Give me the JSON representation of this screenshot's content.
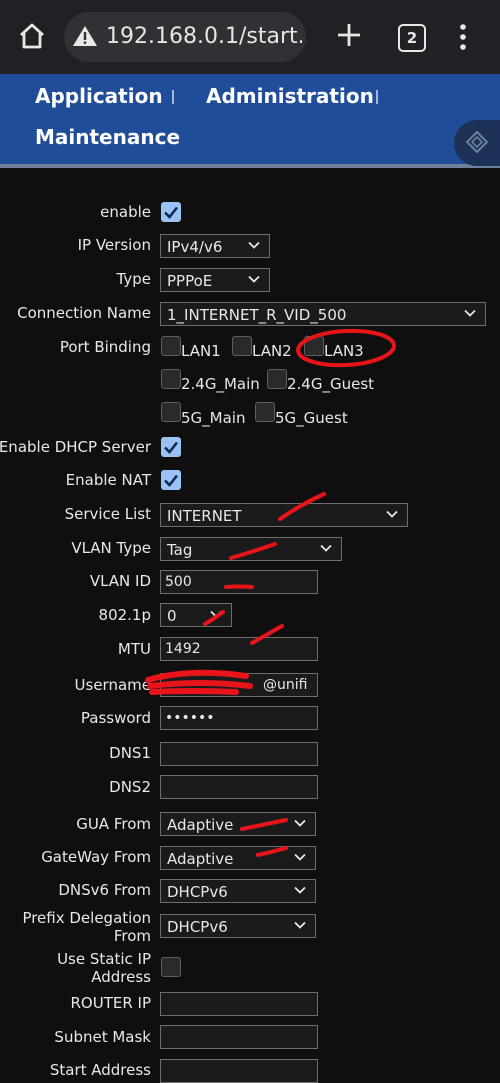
{
  "browser": {
    "url": "192.168.0.1/start.g",
    "tab_count": "2"
  },
  "nav": {
    "items": [
      "Application",
      "Administration",
      "Maintenance"
    ]
  },
  "form": {
    "enable_label": "enable",
    "enable_checked": true,
    "ip_version_label": "IP Version",
    "ip_version_value": "IPv4/v6",
    "type_label": "Type",
    "type_value": "PPPoE",
    "connection_name_label": "Connection Name",
    "connection_name_value": "1_INTERNET_R_VID_500",
    "port_binding_label": "Port Binding",
    "ports": [
      {
        "label": "LAN1",
        "checked": false
      },
      {
        "label": "LAN2",
        "checked": false
      },
      {
        "label": "LAN3",
        "checked": false
      },
      {
        "label": "2.4G_Main",
        "checked": false
      },
      {
        "label": "2.4G_Guest",
        "checked": false
      },
      {
        "label": "5G_Main",
        "checked": false
      },
      {
        "label": "5G_Guest",
        "checked": false
      }
    ],
    "dhcp_label": "Enable DHCP Server",
    "dhcp_checked": true,
    "nat_label": "Enable NAT",
    "nat_checked": true,
    "service_list_label": "Service List",
    "service_list_value": "INTERNET",
    "vlan_type_label": "VLAN Type",
    "vlan_type_value": "Tag",
    "vlan_id_label": "VLAN ID",
    "vlan_id_value": "500",
    "p8021_label": "802.1p",
    "p8021_value": "0",
    "mtu_label": "MTU",
    "mtu_value": "1492",
    "username_label": "Username",
    "username_value": "@unifi",
    "password_label": "Password",
    "password_value": "••••••",
    "dns1_label": "DNS1",
    "dns1_value": "",
    "dns2_label": "DNS2",
    "dns2_value": "",
    "gua_from_label": "GUA From",
    "gua_from_value": "Adaptive",
    "gateway_from_label": "GateWay From",
    "gateway_from_value": "Adaptive",
    "dnsv6_from_label": "DNSv6 From",
    "dnsv6_from_value": "DHCPv6",
    "prefix_label_1": "Prefix Delegation",
    "prefix_label_2": "From",
    "prefix_value": "DHCPv6",
    "static_ip_label_1": "Use Static IP",
    "static_ip_label_2": "Address",
    "static_ip_checked": false,
    "router_ip_label": "ROUTER IP",
    "router_ip_value": "",
    "subnet_mask_label": "Subnet Mask",
    "subnet_mask_value": "",
    "start_address_label": "Start Address",
    "start_address_value": ""
  },
  "colors": {
    "banner": "#1f4d99",
    "checkbox_on": "#9ac2f5",
    "annotation": "#e8141a"
  }
}
